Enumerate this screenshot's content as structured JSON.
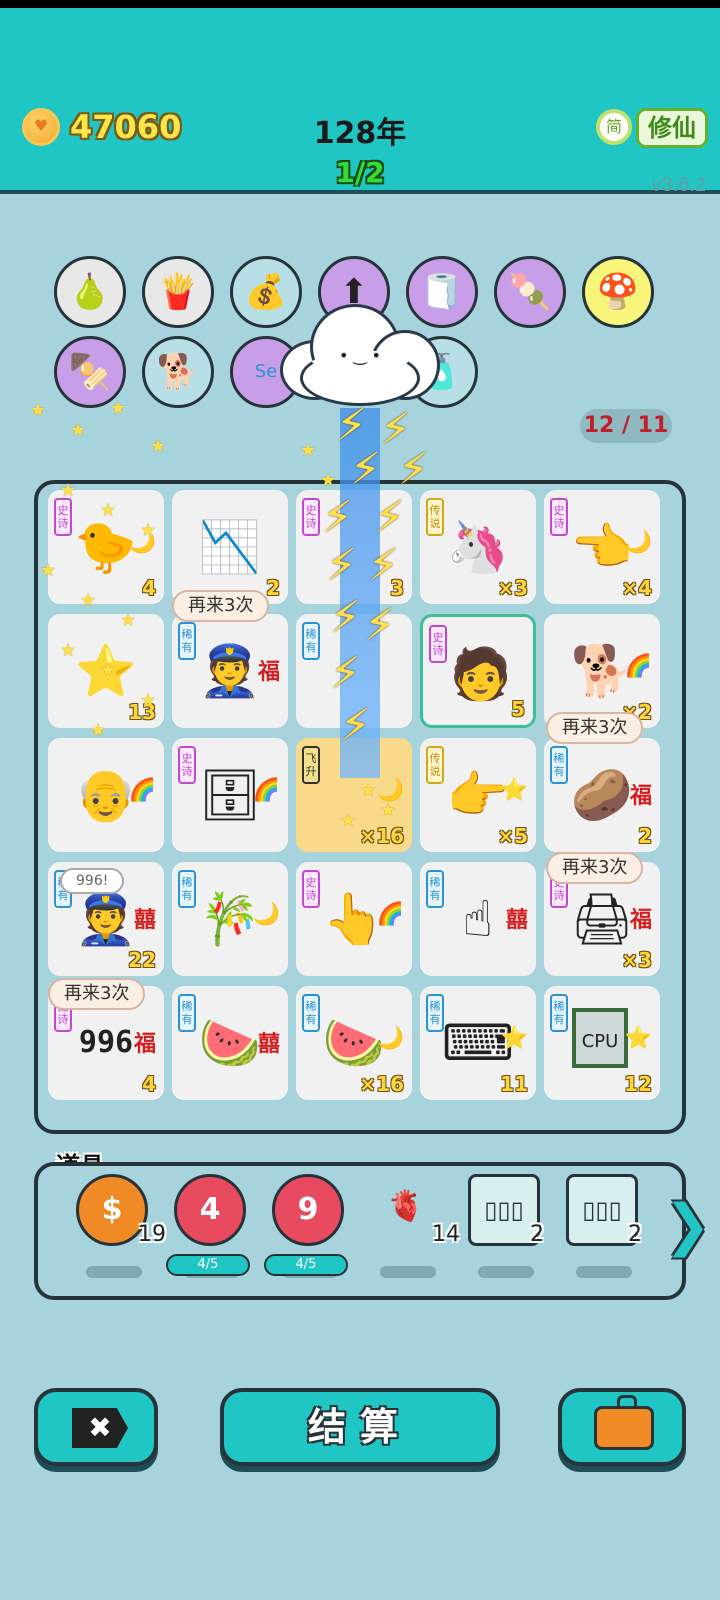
{
  "header": {
    "coins": "47060",
    "year": "128年",
    "round": "1/2",
    "lang_badge": "简",
    "mode_button": "修仙",
    "version": "v3.6.2"
  },
  "effects": {
    "counter": "12 / 11"
  },
  "circles": [
    {
      "name": "lightning-pear-icon",
      "glyph": "🍐",
      "style": "gray"
    },
    {
      "name": "french-fries-icon",
      "glyph": "🍟",
      "style": "gray"
    },
    {
      "name": "money-bag-icon",
      "glyph": "💰",
      "style": "teal"
    },
    {
      "name": "upgrade-arrow-icon",
      "glyph": "⬆",
      "style": "purple"
    },
    {
      "name": "tissue-box-icon",
      "glyph": "🧻",
      "style": "purple"
    },
    {
      "name": "snack-icon",
      "glyph": "🍡",
      "style": "purple"
    },
    {
      "name": "nuke-mushroom-icon",
      "glyph": "🍄",
      "style": "yellow"
    },
    {
      "name": "skewer-icon",
      "glyph": "🍢",
      "style": "purple"
    },
    {
      "name": "husky-icon",
      "glyph": "🐕",
      "style": "teal"
    },
    {
      "name": "screen-icon",
      "glyph": "Se",
      "style": "purple"
    },
    {
      "name": "bottle-icon",
      "glyph": "🧴",
      "style": "teal"
    }
  ],
  "board": {
    "cells": [
      {
        "tag": "史诗",
        "tag_type": "epic",
        "emoji": "🐤",
        "side": "🌙",
        "num": "4",
        "name": "chick-cell"
      },
      {
        "tag": "",
        "tag_type": "",
        "emoji": "📉",
        "side": "",
        "num": "2",
        "name": "chart-cell"
      },
      {
        "tag": "史诗",
        "tag_type": "epic",
        "emoji": "",
        "side": "",
        "num": "3",
        "name": "lightning-cell"
      },
      {
        "tag": "传说",
        "tag_type": "legend",
        "emoji": "🦄",
        "side": "",
        "num": "×3",
        "name": "unicorn-cell"
      },
      {
        "tag": "史诗",
        "tag_type": "epic",
        "emoji": "👈",
        "side": "🌙",
        "num": "×4",
        "name": "hand-cell"
      },
      {
        "tag": "",
        "tag_type": "",
        "emoji": "⭐",
        "side": "",
        "num": "13",
        "name": "star-pile-cell"
      },
      {
        "tag": "稀有",
        "tag_type": "rare",
        "emoji": "👮",
        "side": "福",
        "num": "",
        "name": "police-cell"
      },
      {
        "tag": "稀有",
        "tag_type": "rare",
        "emoji": "",
        "side": "",
        "num": "",
        "name": "lightning-cell-2"
      },
      {
        "tag": "史诗",
        "tag_type": "epic",
        "emoji": "🧑",
        "side": "",
        "num": "5",
        "name": "boy-cell"
      },
      {
        "tag": "",
        "tag_type": "",
        "emoji": "🐕",
        "side": "🌈",
        "num": "×2",
        "name": "husky-cell"
      },
      {
        "tag": "",
        "tag_type": "",
        "emoji": "👴",
        "side": "🌈",
        "num": "",
        "name": "grandpa-cell"
      },
      {
        "tag": "史诗",
        "tag_type": "epic",
        "emoji": "🗄",
        "side": "🌈",
        "num": "",
        "name": "server-cell"
      },
      {
        "tag": "飞升",
        "tag_type": "fly",
        "emoji": "",
        "side": "🌙",
        "num": "×16",
        "name": "ascend-cell"
      },
      {
        "tag": "传说",
        "tag_type": "legend",
        "emoji": "👉",
        "side": "⭐",
        "num": "×5",
        "name": "golden-hand-cell"
      },
      {
        "tag": "稀有",
        "tag_type": "rare",
        "emoji": "🥔",
        "side": "福",
        "num": "2",
        "name": "potato-cell"
      },
      {
        "tag": "稀有",
        "tag_type": "rare",
        "emoji": "👮",
        "side": "囍",
        "num": "22",
        "name": "police-cell-2"
      },
      {
        "tag": "稀有",
        "tag_type": "rare",
        "emoji": "🎋",
        "side": "🌙",
        "num": "",
        "name": "bamboo-cell"
      },
      {
        "tag": "史诗",
        "tag_type": "epic",
        "emoji": "👆",
        "side": "🌈",
        "num": "",
        "name": "point-hand-cell"
      },
      {
        "tag": "稀有",
        "tag_type": "rare",
        "emoji": "☝",
        "side": "囍",
        "num": "",
        "name": "brown-hand-cell"
      },
      {
        "tag": "史诗",
        "tag_type": "epic",
        "emoji": "🖨",
        "side": "福",
        "num": "×3",
        "name": "printer-cell"
      },
      {
        "tag": "史诗",
        "tag_type": "epic",
        "emoji": "",
        "side": "福",
        "num": "4",
        "name": "996-cell"
      },
      {
        "tag": "稀有",
        "tag_type": "rare",
        "emoji": "🍉",
        "side": "囍",
        "num": "",
        "name": "watermelon-cell"
      },
      {
        "tag": "稀有",
        "tag_type": "rare",
        "emoji": "🍉",
        "side": "🌙",
        "num": "×16",
        "name": "watermelon-cell-2"
      },
      {
        "tag": "稀有",
        "tag_type": "rare",
        "emoji": "⌨",
        "side": "⭐",
        "num": "11",
        "name": "keyboard-cell"
      },
      {
        "tag": "稀有",
        "tag_type": "rare",
        "emoji": "",
        "side": "⭐",
        "num": "12",
        "name": "cpu-cell"
      }
    ],
    "digits_996": "996",
    "cpu_label": "CPU",
    "bubbles": {
      "again1": "再来3次",
      "again2": "再来3次",
      "again3": "再来3次",
      "again4": "再来3次",
      "note": "996!"
    }
  },
  "props": {
    "title": "道具",
    "items": [
      {
        "name": "coin-prop",
        "glyph": "$",
        "qty": "19",
        "bar": ""
      },
      {
        "name": "target-4-prop",
        "glyph": "4",
        "qty": "",
        "bar": "4/5"
      },
      {
        "name": "target-9-prop",
        "glyph": "9",
        "qty": "",
        "bar": "4/5"
      },
      {
        "name": "liver-prop",
        "glyph": "🫀",
        "qty": "14",
        "bar": ""
      },
      {
        "name": "rare-cards-prop",
        "glyph": "▯▯▯",
        "qty": "2",
        "bar": ""
      },
      {
        "name": "epic-cards-prop",
        "glyph": "▯▯▯",
        "qty": "2",
        "bar": ""
      }
    ],
    "next_arrow": "❯"
  },
  "buttons": {
    "exit": "✖",
    "settle": "结算"
  }
}
